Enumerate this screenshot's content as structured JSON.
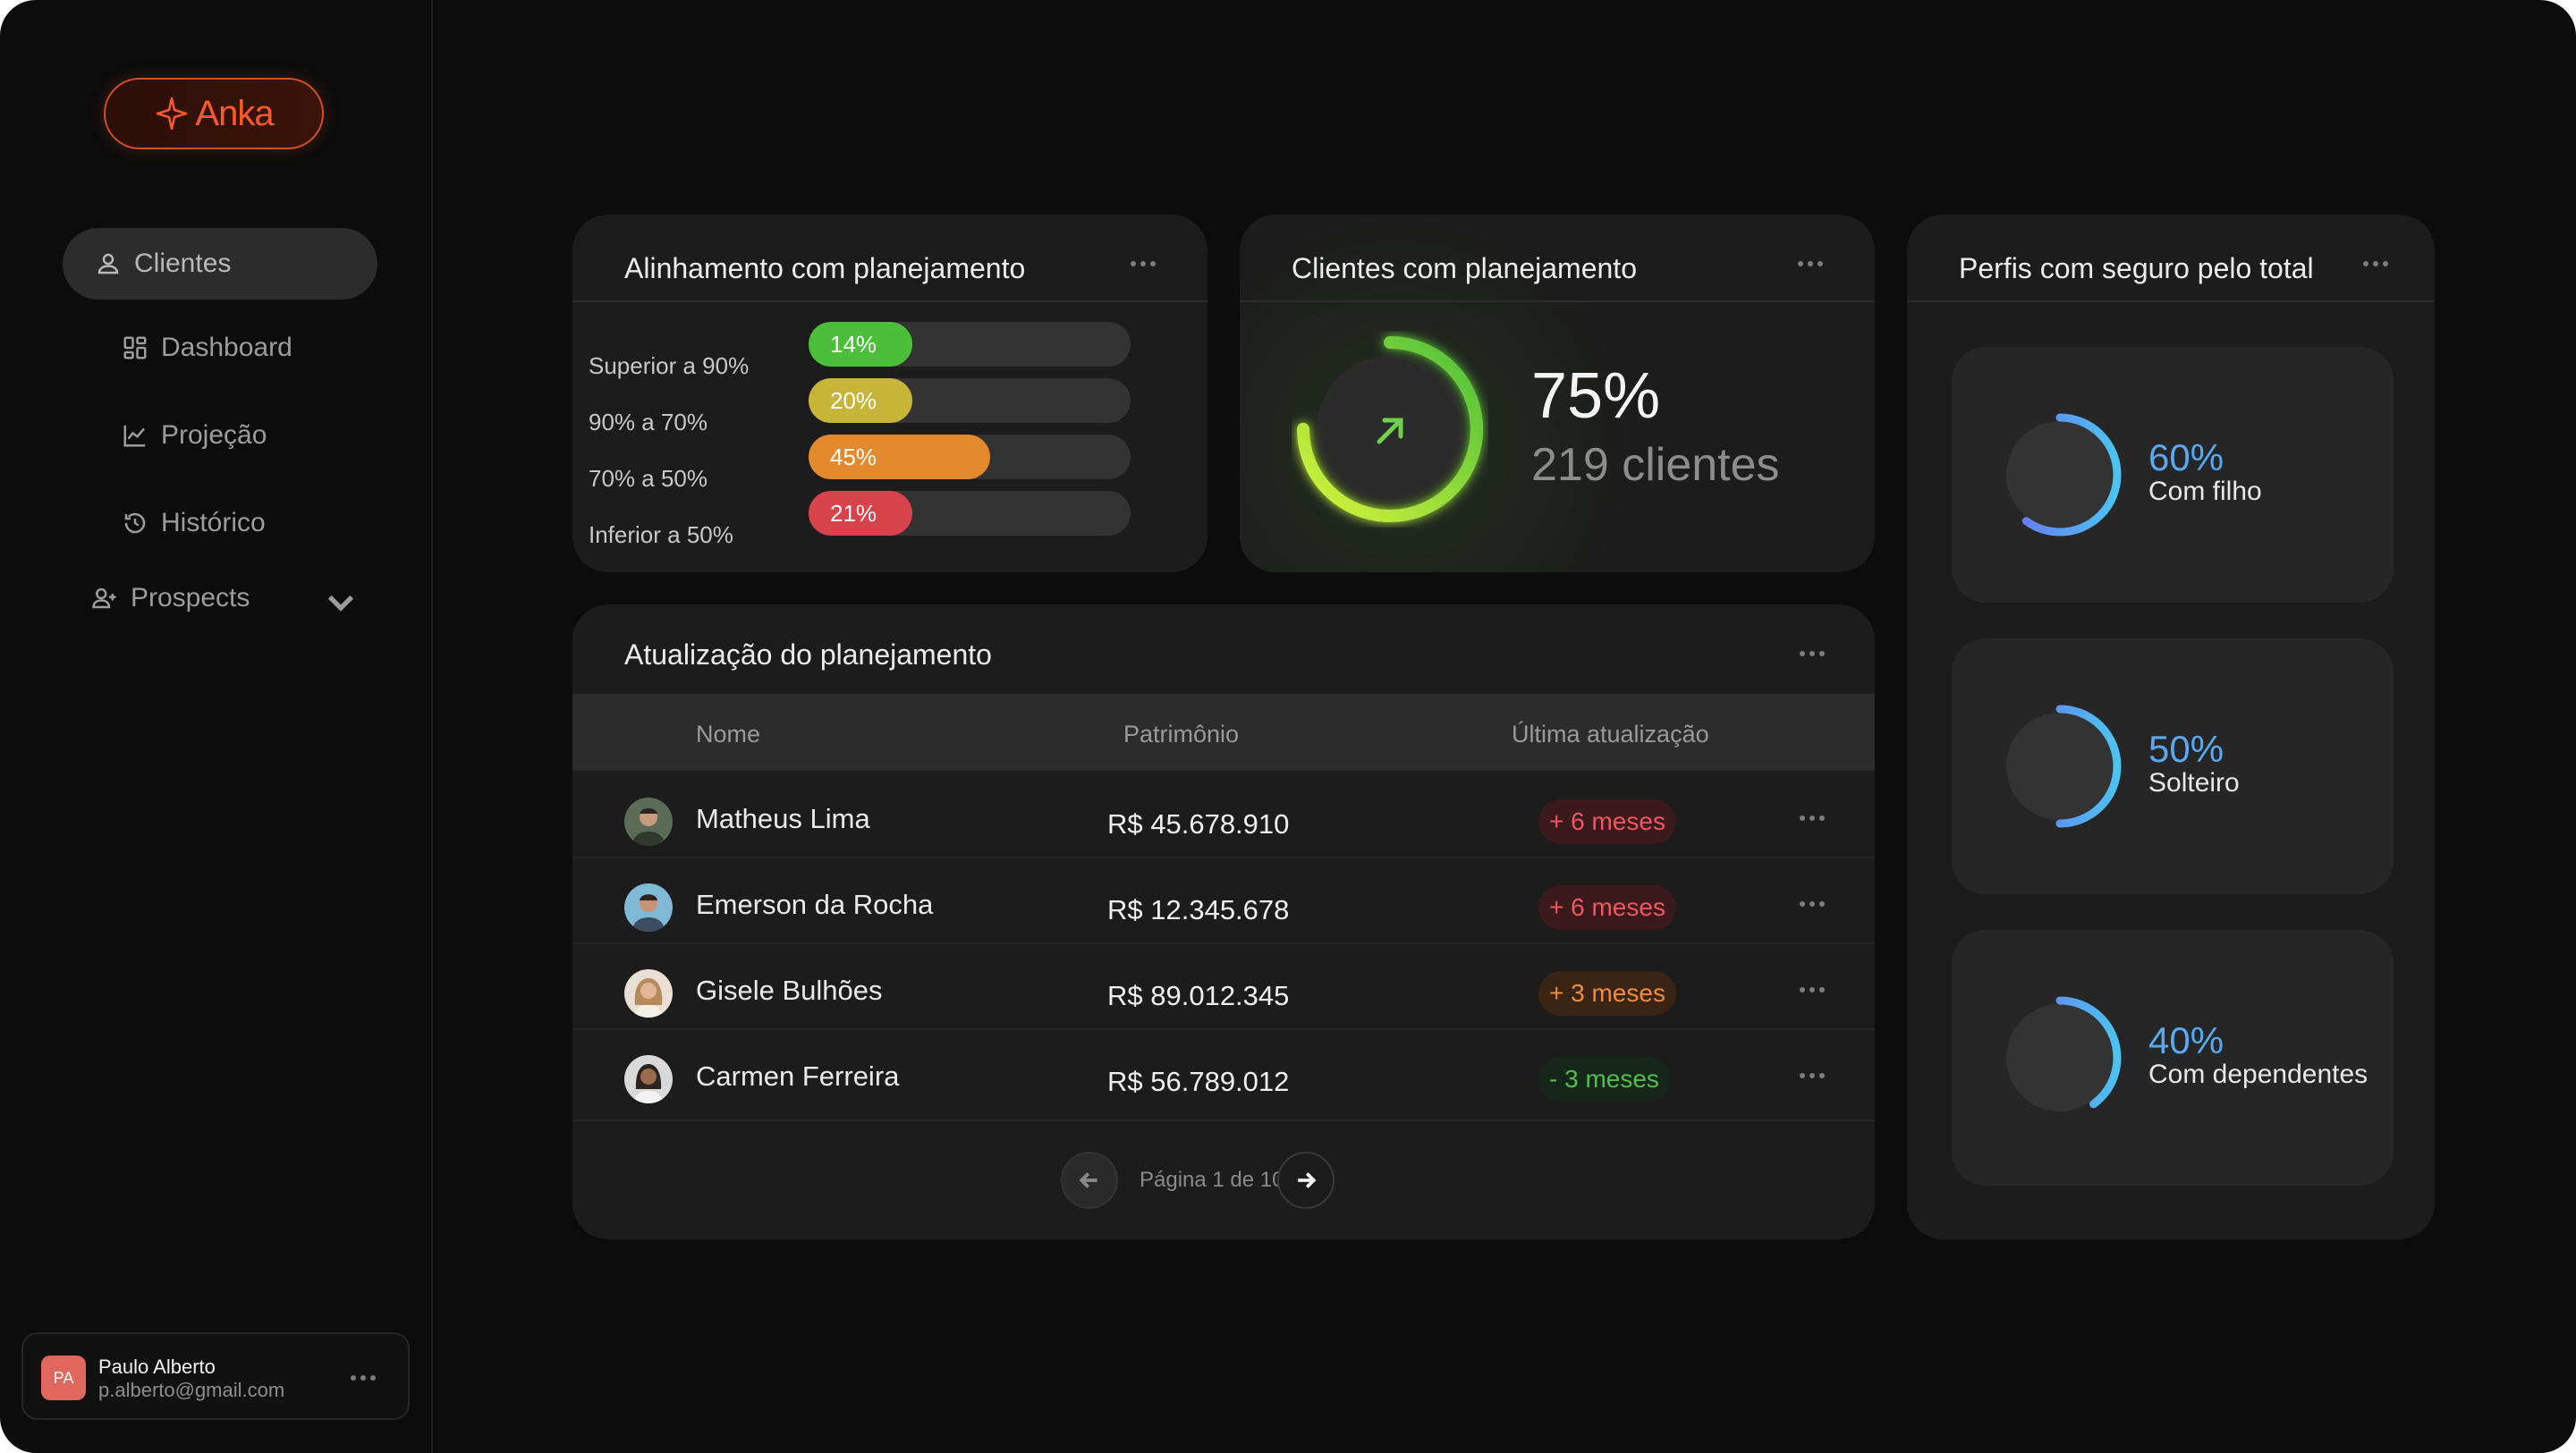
{
  "app": {
    "logo_text": "Anka"
  },
  "sidebar": {
    "items": [
      {
        "label": "Clientes",
        "icon": "user-icon",
        "active": true
      },
      {
        "label": "Dashboard",
        "icon": "dashboard-icon"
      },
      {
        "label": "Projeção",
        "icon": "chart-line-icon"
      },
      {
        "label": "Histórico",
        "icon": "history-icon"
      },
      {
        "label": "Prospects",
        "icon": "user-plus-icon",
        "expandable": true
      }
    ]
  },
  "user": {
    "initials": "PA",
    "name": "Paulo Alberto",
    "email": "p.alberto@gmail.com"
  },
  "alignment": {
    "title": "Alinhamento com planejamento",
    "rows": [
      {
        "label": "Superior a 90%",
        "value": "14%",
        "fraction": 0.14,
        "color": "#4bbf3a"
      },
      {
        "label": "90% a 70%",
        "value": "20%",
        "fraction": 0.2,
        "color": "#c7b53a"
      },
      {
        "label": "70% a 50%",
        "value": "45%",
        "fraction": 0.45,
        "color": "#e38a2e"
      },
      {
        "label": "Inferior a 50%",
        "value": "21%",
        "fraction": 0.21,
        "color": "#d8424a"
      }
    ]
  },
  "planned": {
    "title": "Clientes com planejamento",
    "percent": "75%",
    "fraction": 0.75,
    "count": "219 clientes"
  },
  "profiles": {
    "title": "Perfis com seguro pelo total",
    "items": [
      {
        "percent": "60%",
        "fraction": 0.6,
        "label": "Com filho"
      },
      {
        "percent": "50%",
        "fraction": 0.5,
        "label": "Solteiro"
      },
      {
        "percent": "40%",
        "fraction": 0.4,
        "label": "Com dependentes"
      }
    ]
  },
  "updates": {
    "title": "Atualização do planejamento",
    "columns": [
      "Nome",
      "Patrimônio",
      "Última atualização"
    ],
    "rows": [
      {
        "name": "Matheus Lima",
        "value": "R$ 45.678.910",
        "badge": "+ 6 meses",
        "status": "red"
      },
      {
        "name": "Emerson da Rocha",
        "value": "R$ 12.345.678",
        "badge": "+ 6 meses",
        "status": "red"
      },
      {
        "name": "Gisele Bulhões",
        "value": "R$ 89.012.345",
        "badge": "+ 3 meses",
        "status": "orange"
      },
      {
        "name": "Carmen Ferreira",
        "value": "R$ 56.789.012",
        "badge": "- 3 meses",
        "status": "green"
      }
    ],
    "pagination": "Página 1 de 10"
  }
}
